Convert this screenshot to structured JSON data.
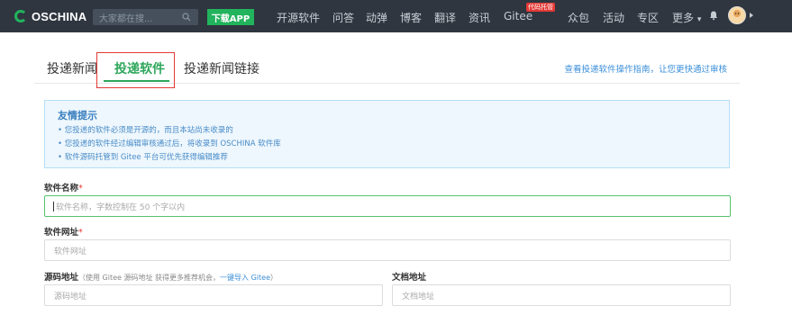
{
  "topbar": {
    "logo_text": "OSCHINA",
    "search_placeholder": "大家都在搜...",
    "download_label": "下载APP",
    "nav": [
      "开源软件",
      "问答",
      "动弹",
      "博客",
      "翻译",
      "资讯",
      "Gitee",
      "众包",
      "活动",
      "专区",
      "更多"
    ],
    "gitee_badge": "代码托管",
    "more_caret": "▾"
  },
  "tabs": {
    "news": "投递新闻",
    "software": "投递软件",
    "news_link": "投递新闻链接",
    "guide_link": "查看投递软件操作指南，让您更快通过审核"
  },
  "tips": {
    "title": "友情提示",
    "items": [
      "• 您投递的软件必须是开源的，而且本站尚未收录的",
      "• 您投递的软件经过编辑审核通过后，将收录到 OSCHINA 软件库",
      "• 软件源码托管到 Gitee 平台可优先获得编辑推荐"
    ]
  },
  "form": {
    "name_label": "软件名称",
    "name_placeholder": "软件名称，字数控制在 50 个字以内",
    "url_label": "软件网址",
    "url_placeholder": "软件网址",
    "source_label": "源码地址",
    "source_hint": "（使用 Gitee 源码地址 获得更多推荐机会，",
    "source_hint_link": "一键导入 Gitee",
    "source_hint_end": "）",
    "source_placeholder": "源码地址",
    "doc_label": "文档地址",
    "doc_placeholder": "文档地址",
    "required_mark": "*"
  },
  "colors": {
    "topbar_bg": "#2f3640",
    "brand_green": "#2ca65a",
    "link_blue": "#3b8fd9",
    "highlight_red": "#e53935"
  }
}
